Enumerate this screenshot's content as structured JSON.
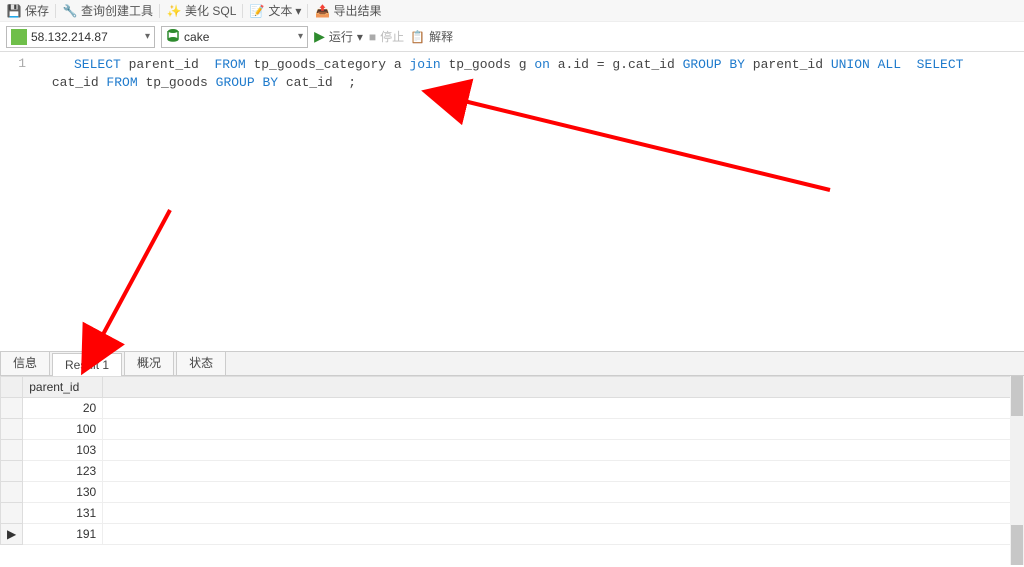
{
  "toolbar_top": {
    "save": "保存",
    "querybuilder": "查询创建工具",
    "beautify": "美化 SQL",
    "text": "文本",
    "export": "导出结果"
  },
  "toolbar_main": {
    "server": "58.132.214.87",
    "database": "cake",
    "run": "运行",
    "stop": "停止",
    "explain": "解释"
  },
  "editor": {
    "line1_no": "1",
    "sql": {
      "kw1": "SELECT",
      "t1": " parent_id  ",
      "kw2": "FROM",
      "t2": " tp_goods_category a ",
      "kw3": "join",
      "t3": " tp_goods g ",
      "kw4": "on",
      "t4": " a.id = g.cat_id ",
      "kw5": "GROUP",
      "kw6": " BY",
      "t5": " parent_id ",
      "kw7": "UNION",
      "kw8": " ALL",
      "t6": "  ",
      "kw9": "SELECT",
      "t7": " cat_id ",
      "kw10": "FROM",
      "t8": " tp_goods ",
      "kw11": "GROUP",
      "kw12": " BY",
      "t9": " cat_id  ;"
    }
  },
  "result_tabs": {
    "info": "信息",
    "result1": "Result 1",
    "profile": "概况",
    "status": "状态"
  },
  "result": {
    "column": "parent_id",
    "rows": [
      "20",
      "100",
      "103",
      "123",
      "130",
      "131",
      "191"
    ]
  },
  "pointer_symbol": "▶"
}
